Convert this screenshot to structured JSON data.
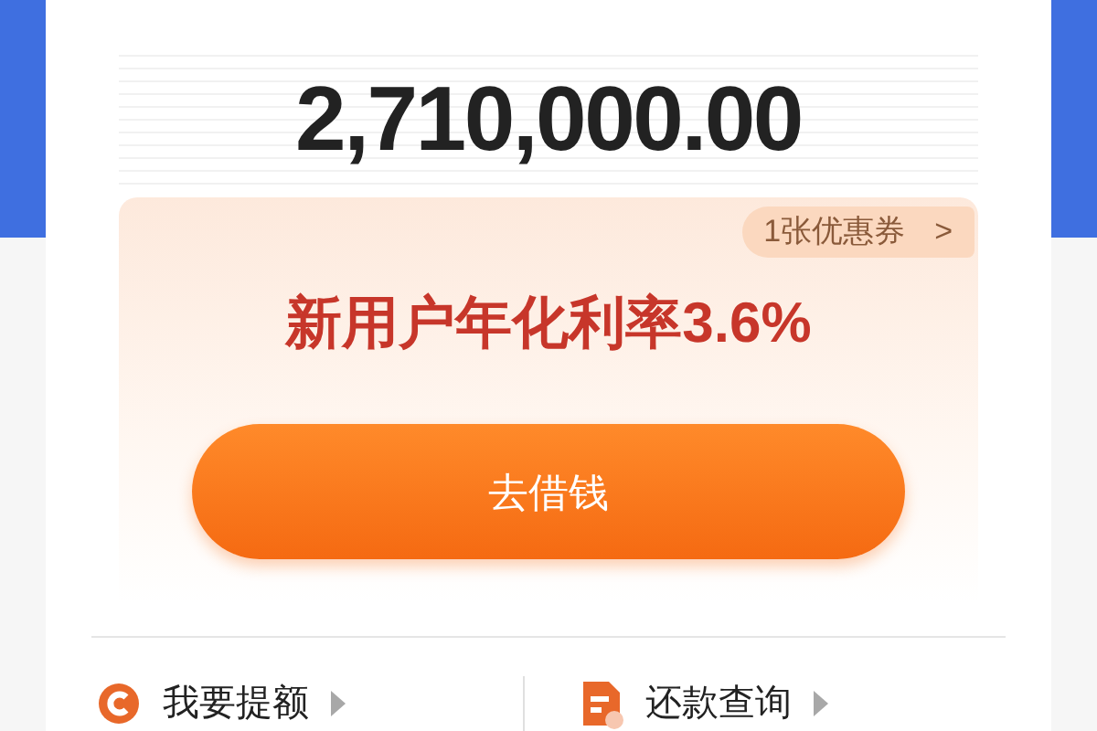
{
  "amount": "2,710,000.00",
  "coupon": {
    "label": "1张优惠券",
    "chevron": ">"
  },
  "promo": "新用户年化利率3.6%",
  "action_button": "去借钱",
  "shortcuts": [
    {
      "kind": "raise",
      "label": "我要提额"
    },
    {
      "kind": "repay",
      "label": "还款查询"
    }
  ]
}
